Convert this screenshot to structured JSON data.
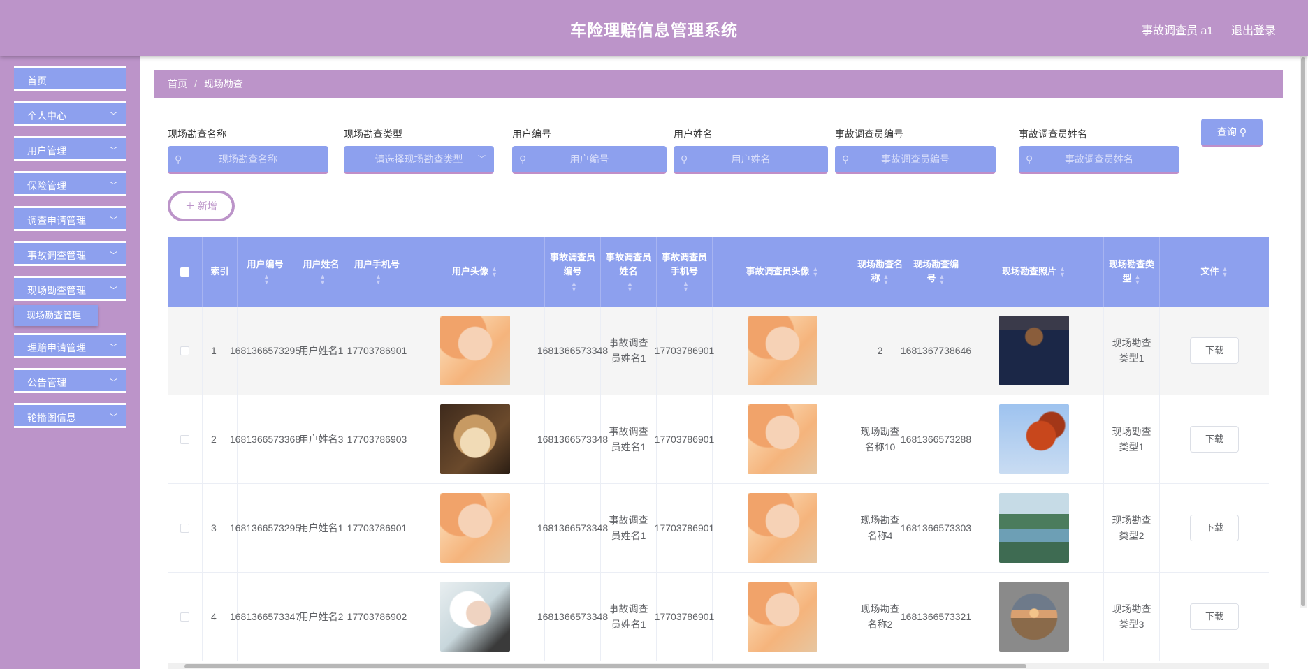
{
  "header": {
    "title": "车险理赔信息管理系统",
    "user": "事故调查员 a1",
    "logout": "退出登录"
  },
  "sidebar": {
    "items": [
      {
        "label": "首页",
        "has_children": false
      },
      {
        "label": "个人中心",
        "has_children": true
      },
      {
        "label": "用户管理",
        "has_children": true
      },
      {
        "label": "保险管理",
        "has_children": true
      },
      {
        "label": "调查申请管理",
        "has_children": true
      },
      {
        "label": "事故调查管理",
        "has_children": true
      },
      {
        "label": "现场勘查管理",
        "has_children": true
      },
      {
        "label": "理赔申请管理",
        "has_children": true
      },
      {
        "label": "公告管理",
        "has_children": true
      },
      {
        "label": "轮播图信息",
        "has_children": true
      }
    ],
    "active_sub": "现场勘查管理"
  },
  "breadcrumb": {
    "home": "首页",
    "current": "现场勘查"
  },
  "filters": [
    {
      "label": "现场勘查名称",
      "placeholder": "现场勘查名称"
    },
    {
      "label": "现场勘查类型",
      "placeholder": "请选择现场勘查类型"
    },
    {
      "label": "用户编号",
      "placeholder": "用户编号"
    },
    {
      "label": "用户姓名",
      "placeholder": "用户姓名"
    },
    {
      "label": "事故调查员编号",
      "placeholder": "事故调查员编号"
    },
    {
      "label": "事故调查员姓名",
      "placeholder": "事故调查员姓名"
    }
  ],
  "query_label": "查询",
  "add_label": "新增",
  "table": {
    "columns": [
      "索引",
      "用户编号",
      "用户姓名",
      "用户手机号",
      "用户头像",
      "事故调查员编号",
      "事故调查员姓名",
      "事故调查员手机号",
      "事故调查员头像",
      "现场勘查名称",
      "现场勘查编号",
      "现场勘查照片",
      "现场勘查类型",
      "文件"
    ],
    "download_label": "下载",
    "rows": [
      {
        "index": "1",
        "user_no": "1681366573295",
        "user_name": "用户姓名1",
        "user_phone": "17703786901",
        "user_avatar": "girl",
        "inv_no": "1681366573348",
        "inv_name": "事故调查员姓名1",
        "inv_phone": "17703786901",
        "inv_avatar": "girl",
        "survey_name": "2",
        "survey_no": "1681367738646",
        "survey_photo": "player",
        "survey_type": "现场勘查类型1"
      },
      {
        "index": "2",
        "user_no": "1681366573368",
        "user_name": "用户姓名3",
        "user_phone": "17703786903",
        "user_avatar": "dog",
        "inv_no": "1681366573348",
        "inv_name": "事故调查员姓名1",
        "inv_phone": "17703786901",
        "inv_avatar": "girl",
        "survey_name": "现场勘查名称10",
        "survey_no": "1681366573288",
        "survey_photo": "leaves",
        "survey_type": "现场勘查类型1"
      },
      {
        "index": "3",
        "user_no": "1681366573295",
        "user_name": "用户姓名1",
        "user_phone": "17703786901",
        "user_avatar": "girl",
        "inv_no": "1681366573348",
        "inv_name": "事故调查员姓名1",
        "inv_phone": "17703786901",
        "inv_avatar": "girl",
        "survey_name": "现场勘查名称4",
        "survey_no": "1681366573303",
        "survey_photo": "lake",
        "survey_type": "现场勘查类型2"
      },
      {
        "index": "4",
        "user_no": "1681366573347",
        "user_name": "用户姓名2",
        "user_phone": "17703786902",
        "user_avatar": "boy",
        "inv_no": "1681366573348",
        "inv_name": "事故调查员姓名1",
        "inv_phone": "17703786901",
        "inv_avatar": "girl",
        "survey_name": "现场勘查名称2",
        "survey_no": "1681366573321",
        "survey_photo": "sunset",
        "survey_type": "现场勘查类型3"
      }
    ]
  },
  "colors": {
    "header": "#bc94c9",
    "accent": "#8da0ee"
  }
}
